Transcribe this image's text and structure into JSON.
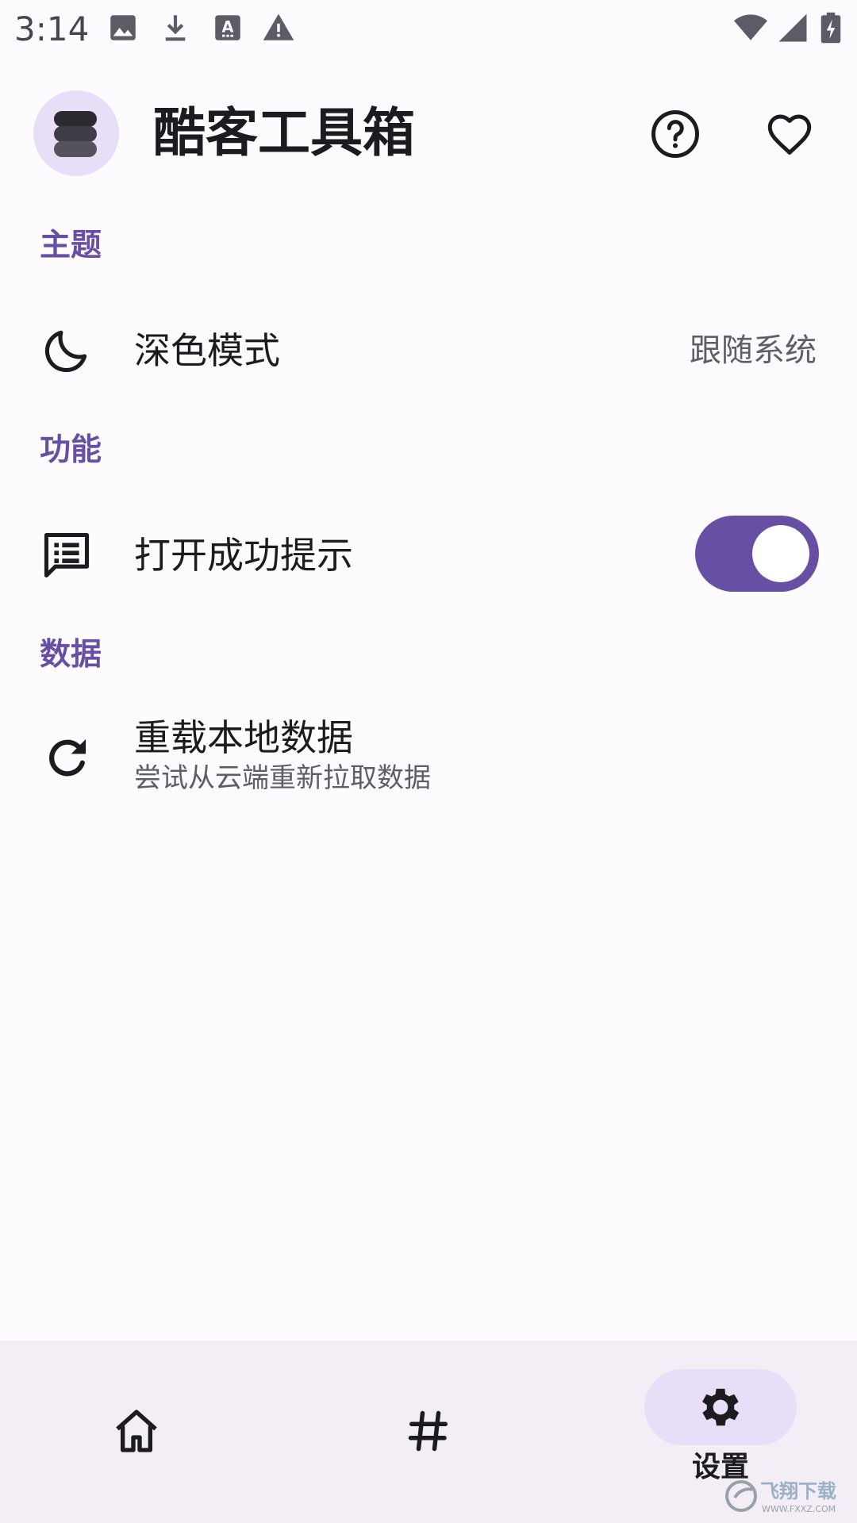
{
  "status_bar": {
    "time": "3:14",
    "icons": [
      "image-icon",
      "download-icon",
      "font-a-icon",
      "warning-icon",
      "wifi-icon",
      "signal-icon",
      "battery-charging-icon"
    ]
  },
  "header": {
    "title": "酷客工具箱",
    "logo_icon": "layers-icon",
    "actions": [
      "help-icon",
      "favorite-icon"
    ]
  },
  "sections": {
    "theme": {
      "title": "主题",
      "dark_mode": {
        "icon": "moon-icon",
        "label": "深色模式",
        "value": "跟随系统"
      }
    },
    "features": {
      "title": "功能",
      "success_tip": {
        "icon": "message-icon",
        "label": "打开成功提示",
        "enabled": true
      }
    },
    "data": {
      "title": "数据",
      "reload": {
        "icon": "refresh-icon",
        "label": "重载本地数据",
        "subtitle": "尝试从云端重新拉取数据"
      }
    }
  },
  "bottom_nav": {
    "items": [
      {
        "icon": "home-icon",
        "selected": false
      },
      {
        "icon": "hashtag-icon",
        "selected": false
      },
      {
        "icon": "gear-icon",
        "label": "设置",
        "selected": true
      }
    ]
  },
  "colors": {
    "accent": "#6750a4",
    "pill": "#e8def8",
    "nav_background": "#f3eef6",
    "background": "#fdfbfe"
  },
  "watermark": {
    "text": "飞翔下载",
    "url_text": "WWW.FXXZ.COM"
  }
}
